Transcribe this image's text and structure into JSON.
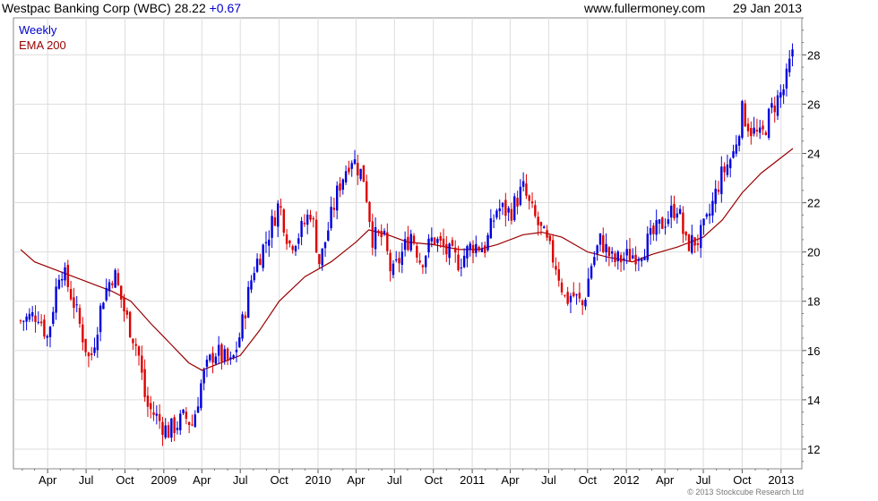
{
  "header": {
    "title": "Westpac Banking Corp (WBC) 28.22",
    "change": "+0.67",
    "site": "www.fullermoney.com",
    "date": "29 Jan 2013"
  },
  "legend": {
    "period": "Weekly",
    "ema": "EMA 200",
    "period_color": "#0000cc",
    "ema_color": "#990000"
  },
  "footer": {
    "copyright": "© 2013 Stockcube Research Ltd"
  },
  "chart_data": {
    "type": "candlestick",
    "title": "Westpac Banking Corp (WBC) 28.22 +0.67",
    "frequency": "Weekly",
    "xlabel": "",
    "ylabel": "",
    "ylim": [
      11.2,
      29.5
    ],
    "y_ticks": [
      12,
      14,
      16,
      18,
      20,
      22,
      24,
      26,
      28
    ],
    "y_axis_side": "right",
    "grid": true,
    "up_color": "#0000dd",
    "down_color": "#dd0000",
    "x_ticks": [
      "Apr",
      "Jul",
      "Oct",
      "2009",
      "Apr",
      "Jul",
      "Oct",
      "2010",
      "Apr",
      "Jul",
      "Oct",
      "2011",
      "Apr",
      "Jul",
      "Oct",
      "2012",
      "Apr",
      "Jul",
      "Oct",
      "2013"
    ],
    "price_path": [
      [
        "2008-01-28",
        17.2
      ],
      [
        "2008-03-10",
        17.5
      ],
      [
        "2008-04-01",
        16.5
      ],
      [
        "2008-05-01",
        19.5
      ],
      [
        "2008-06-01",
        18.0
      ],
      [
        "2008-07-10",
        15.5
      ],
      [
        "2008-08-10",
        18.2
      ],
      [
        "2008-09-05",
        19.2
      ],
      [
        "2008-10-01",
        17.5
      ],
      [
        "2008-11-01",
        16.0
      ],
      [
        "2008-11-20",
        13.8
      ],
      [
        "2008-12-15",
        13.3
      ],
      [
        "2009-01-10",
        12.7
      ],
      [
        "2009-02-20",
        13.3
      ],
      [
        "2009-03-10",
        13.0
      ],
      [
        "2009-04-01",
        14.8
      ],
      [
        "2009-05-01",
        16.0
      ],
      [
        "2009-06-10",
        15.4
      ],
      [
        "2009-07-01",
        16.7
      ],
      [
        "2009-08-01",
        19.3
      ],
      [
        "2009-09-01",
        20.5
      ],
      [
        "2009-10-01",
        22.0
      ],
      [
        "2009-10-25",
        20.3
      ],
      [
        "2009-11-20",
        20.8
      ],
      [
        "2009-12-15",
        21.7
      ],
      [
        "2010-01-05",
        19.5
      ],
      [
        "2010-01-20",
        20.6
      ],
      [
        "2010-02-20",
        22.7
      ],
      [
        "2010-03-20",
        23.9
      ],
      [
        "2010-04-20",
        23.0
      ],
      [
        "2010-05-10",
        20.6
      ],
      [
        "2010-06-05",
        20.6
      ],
      [
        "2010-06-25",
        19.0
      ],
      [
        "2010-07-15",
        19.8
      ],
      [
        "2010-08-10",
        20.8
      ],
      [
        "2010-09-01",
        19.6
      ],
      [
        "2010-10-01",
        20.6
      ],
      [
        "2010-11-01",
        20.0
      ],
      [
        "2010-12-01",
        19.6
      ],
      [
        "2011-01-01",
        20.3
      ],
      [
        "2011-02-01",
        20.2
      ],
      [
        "2011-03-01",
        21.8
      ],
      [
        "2011-04-01",
        21.6
      ],
      [
        "2011-05-01",
        22.6
      ],
      [
        "2011-05-20",
        21.7
      ],
      [
        "2011-06-20",
        20.6
      ],
      [
        "2011-07-20",
        19.4
      ],
      [
        "2011-08-10",
        18.0
      ],
      [
        "2011-08-25",
        18.3
      ],
      [
        "2011-09-20",
        17.8
      ],
      [
        "2011-10-10",
        19.5
      ],
      [
        "2011-11-01",
        20.5
      ],
      [
        "2011-12-01",
        19.6
      ],
      [
        "2012-01-01",
        19.8
      ],
      [
        "2012-02-01",
        20.0
      ],
      [
        "2012-03-01",
        20.6
      ],
      [
        "2012-04-01",
        21.3
      ],
      [
        "2012-05-01",
        21.9
      ],
      [
        "2012-05-20",
        20.3
      ],
      [
        "2012-06-20",
        20.5
      ],
      [
        "2012-07-10",
        21.2
      ],
      [
        "2012-08-10",
        23.0
      ],
      [
        "2012-09-10",
        24.0
      ],
      [
        "2012-10-01",
        25.7
      ],
      [
        "2012-10-20",
        25.0
      ],
      [
        "2012-11-15",
        24.6
      ],
      [
        "2012-12-10",
        25.8
      ],
      [
        "2013-01-10",
        26.7
      ],
      [
        "2013-01-29",
        28.22
      ]
    ],
    "ema_200_path": [
      [
        "2008-01-28",
        20.1
      ],
      [
        "2008-03-01",
        19.6
      ],
      [
        "2008-06-01",
        19.0
      ],
      [
        "2008-09-01",
        18.4
      ],
      [
        "2008-10-15",
        18.0
      ],
      [
        "2008-12-01",
        17.1
      ],
      [
        "2009-01-15",
        16.3
      ],
      [
        "2009-03-01",
        15.5
      ],
      [
        "2009-04-01",
        15.2
      ],
      [
        "2009-05-01",
        15.4
      ],
      [
        "2009-07-01",
        15.8
      ],
      [
        "2009-08-15",
        16.8
      ],
      [
        "2009-10-01",
        18.0
      ],
      [
        "2009-12-01",
        19.0
      ],
      [
        "2010-02-01",
        19.6
      ],
      [
        "2010-04-01",
        20.4
      ],
      [
        "2010-05-01",
        20.9
      ],
      [
        "2010-06-15",
        20.7
      ],
      [
        "2010-08-01",
        20.4
      ],
      [
        "2010-10-01",
        20.3
      ],
      [
        "2010-12-01",
        20.1
      ],
      [
        "2011-01-15",
        20.1
      ],
      [
        "2011-03-01",
        20.3
      ],
      [
        "2011-05-01",
        20.7
      ],
      [
        "2011-06-15",
        20.8
      ],
      [
        "2011-08-01",
        20.6
      ],
      [
        "2011-10-01",
        20.0
      ],
      [
        "2011-11-15",
        19.8
      ],
      [
        "2012-01-15",
        19.6
      ],
      [
        "2012-03-01",
        19.9
      ],
      [
        "2012-05-01",
        20.2
      ],
      [
        "2012-07-01",
        20.6
      ],
      [
        "2012-08-15",
        21.3
      ],
      [
        "2012-10-01",
        22.4
      ],
      [
        "2012-11-15",
        23.2
      ],
      [
        "2013-01-29",
        24.2
      ]
    ]
  }
}
